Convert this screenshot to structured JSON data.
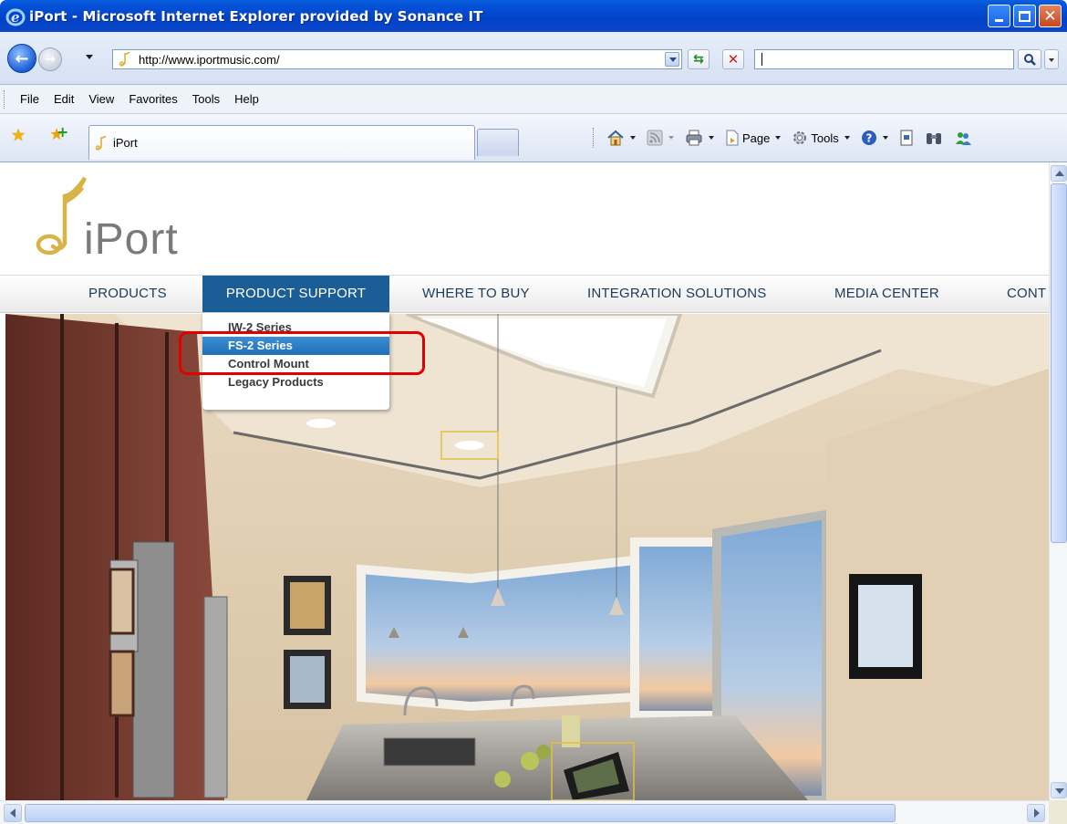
{
  "window": {
    "title": "iPort - Microsoft Internet Explorer provided by Sonance IT",
    "icon": "ie-logo-icon",
    "controls": [
      "minimize-icon",
      "maximize-icon",
      "close-icon"
    ]
  },
  "address_bar": {
    "url": "http://www.iportmusic.com/",
    "search_value": ""
  },
  "menu": {
    "items": [
      "File",
      "Edit",
      "View",
      "Favorites",
      "Tools",
      "Help"
    ]
  },
  "tabs": {
    "active_label": "iPort"
  },
  "command_bar": {
    "page_label": "Page",
    "tools_label": "Tools"
  },
  "site": {
    "logo_text": "iPort",
    "nav": [
      "PRODUCTS",
      "PRODUCT SUPPORT",
      "WHERE TO BUY",
      "INTEGRATION SOLUTIONS",
      "MEDIA CENTER",
      "CONT"
    ],
    "active_nav": "PRODUCT SUPPORT",
    "dropdown": [
      "IW-2 Series",
      "FS-2 Series",
      "Control Mount",
      "Legacy Products"
    ],
    "dropdown_selected": "FS-2 Series"
  },
  "colors": {
    "titlebar": "#0553d8",
    "nav_active": "#1b5d97",
    "highlight": "#e10000",
    "dropdown_selected": "#2a7cc4"
  }
}
